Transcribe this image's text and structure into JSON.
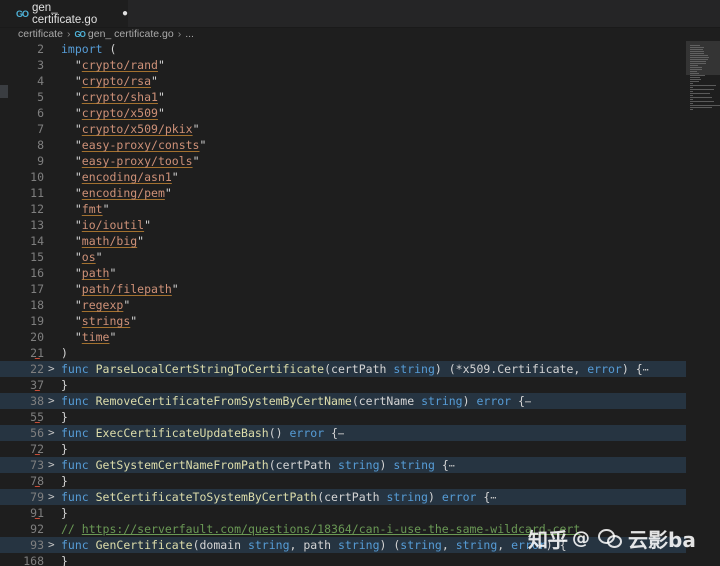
{
  "tab": {
    "filename": "gen_ certificate.go",
    "icon": "go-file-icon",
    "modified_indicator": "●"
  },
  "breadcrumb": {
    "folder": "certificate",
    "file": "gen_ certificate.go",
    "more": "..."
  },
  "lines": [
    {
      "n": "2",
      "fold": "",
      "parts": [
        [
          "kw",
          "import"
        ],
        [
          "p",
          " ("
        ]
      ]
    },
    {
      "n": "3",
      "fold": "",
      "parts": [
        [
          "p",
          "  \""
        ],
        [
          "str",
          "crypto/rand"
        ],
        [
          "p",
          "\""
        ]
      ]
    },
    {
      "n": "4",
      "fold": "",
      "parts": [
        [
          "p",
          "  \""
        ],
        [
          "str",
          "crypto/rsa"
        ],
        [
          "p",
          "\""
        ]
      ]
    },
    {
      "n": "5",
      "fold": "",
      "parts": [
        [
          "p",
          "  \""
        ],
        [
          "str",
          "crypto/sha1"
        ],
        [
          "p",
          "\""
        ]
      ]
    },
    {
      "n": "6",
      "fold": "",
      "parts": [
        [
          "p",
          "  \""
        ],
        [
          "str",
          "crypto/x509"
        ],
        [
          "p",
          "\""
        ]
      ]
    },
    {
      "n": "7",
      "fold": "",
      "parts": [
        [
          "p",
          "  \""
        ],
        [
          "str",
          "crypto/x509/pkix"
        ],
        [
          "p",
          "\""
        ]
      ]
    },
    {
      "n": "8",
      "fold": "",
      "parts": [
        [
          "p",
          "  \""
        ],
        [
          "str",
          "easy-proxy/consts"
        ],
        [
          "p",
          "\""
        ]
      ]
    },
    {
      "n": "9",
      "fold": "",
      "parts": [
        [
          "p",
          "  \""
        ],
        [
          "str",
          "easy-proxy/tools"
        ],
        [
          "p",
          "\""
        ]
      ]
    },
    {
      "n": "10",
      "fold": "",
      "parts": [
        [
          "p",
          "  \""
        ],
        [
          "str",
          "encoding/asn1"
        ],
        [
          "p",
          "\""
        ]
      ]
    },
    {
      "n": "11",
      "fold": "",
      "parts": [
        [
          "p",
          "  \""
        ],
        [
          "str",
          "encoding/pem"
        ],
        [
          "p",
          "\""
        ]
      ]
    },
    {
      "n": "12",
      "fold": "",
      "parts": [
        [
          "p",
          "  \""
        ],
        [
          "str",
          "fmt"
        ],
        [
          "p",
          "\""
        ]
      ]
    },
    {
      "n": "13",
      "fold": "",
      "parts": [
        [
          "p",
          "  \""
        ],
        [
          "str",
          "io/ioutil"
        ],
        [
          "p",
          "\""
        ]
      ]
    },
    {
      "n": "14",
      "fold": "",
      "parts": [
        [
          "p",
          "  \""
        ],
        [
          "str",
          "math/big"
        ],
        [
          "p",
          "\""
        ]
      ]
    },
    {
      "n": "15",
      "fold": "",
      "parts": [
        [
          "p",
          "  \""
        ],
        [
          "str",
          "os"
        ],
        [
          "p",
          "\""
        ]
      ]
    },
    {
      "n": "16",
      "fold": "",
      "parts": [
        [
          "p",
          "  \""
        ],
        [
          "str",
          "path"
        ],
        [
          "p",
          "\""
        ]
      ]
    },
    {
      "n": "17",
      "fold": "",
      "parts": [
        [
          "p",
          "  \""
        ],
        [
          "str",
          "path/filepath"
        ],
        [
          "p",
          "\""
        ]
      ]
    },
    {
      "n": "18",
      "fold": "",
      "parts": [
        [
          "p",
          "  \""
        ],
        [
          "str",
          "regexp"
        ],
        [
          "p",
          "\""
        ]
      ]
    },
    {
      "n": "19",
      "fold": "",
      "parts": [
        [
          "p",
          "  \""
        ],
        [
          "str",
          "strings"
        ],
        [
          "p",
          "\""
        ]
      ]
    },
    {
      "n": "20",
      "fold": "",
      "parts": [
        [
          "p",
          "  \""
        ],
        [
          "str",
          "time"
        ],
        [
          "p",
          "\""
        ]
      ]
    },
    {
      "n": "21",
      "fold": "",
      "parts": [
        [
          "p",
          ")"
        ]
      ]
    },
    {
      "n": "22",
      "fold": ">",
      "hl": true,
      "parts": [
        [
          "kw",
          "func "
        ],
        [
          "fn",
          "ParseLocalCertStringToCertificate"
        ],
        [
          "p",
          "(certPath "
        ],
        [
          "ty",
          "string"
        ],
        [
          "p",
          ") (*x509.Certificate, "
        ],
        [
          "ty",
          "error"
        ],
        [
          "p",
          ") {"
        ],
        [
          "ell",
          "⋯"
        ]
      ]
    },
    {
      "n": "37",
      "fold": "",
      "parts": [
        [
          "p",
          "}"
        ]
      ]
    },
    {
      "n": "38",
      "fold": ">",
      "hl": true,
      "parts": [
        [
          "kw",
          "func "
        ],
        [
          "fn",
          "RemoveCertificateFromSystemByCertName"
        ],
        [
          "p",
          "(certName "
        ],
        [
          "ty",
          "string"
        ],
        [
          "p",
          ") "
        ],
        [
          "ty",
          "error"
        ],
        [
          "p",
          " {"
        ],
        [
          "ell",
          "⋯"
        ]
      ]
    },
    {
      "n": "55",
      "fold": "",
      "parts": [
        [
          "p",
          "}"
        ]
      ]
    },
    {
      "n": "56",
      "fold": ">",
      "hl": true,
      "parts": [
        [
          "kw",
          "func "
        ],
        [
          "fn",
          "ExecCertificateUpdateBash"
        ],
        [
          "p",
          "() "
        ],
        [
          "ty",
          "error"
        ],
        [
          "p",
          " {"
        ],
        [
          "ell",
          "⋯"
        ]
      ]
    },
    {
      "n": "72",
      "fold": "",
      "parts": [
        [
          "p",
          "}"
        ]
      ]
    },
    {
      "n": "73",
      "fold": ">",
      "hl": true,
      "parts": [
        [
          "kw",
          "func "
        ],
        [
          "fn",
          "GetSystemCertNameFromPath"
        ],
        [
          "p",
          "(certPath "
        ],
        [
          "ty",
          "string"
        ],
        [
          "p",
          ") "
        ],
        [
          "ty",
          "string"
        ],
        [
          "p",
          " {"
        ],
        [
          "ell",
          "⋯"
        ]
      ]
    },
    {
      "n": "78",
      "fold": "",
      "parts": [
        [
          "p",
          "}"
        ]
      ]
    },
    {
      "n": "79",
      "fold": ">",
      "hl": true,
      "parts": [
        [
          "kw",
          "func "
        ],
        [
          "fn",
          "SetCertificateToSystemByCertPath"
        ],
        [
          "p",
          "(certPath "
        ],
        [
          "ty",
          "string"
        ],
        [
          "p",
          ") "
        ],
        [
          "ty",
          "error"
        ],
        [
          "p",
          " {"
        ],
        [
          "ell",
          "⋯"
        ]
      ]
    },
    {
      "n": "91",
      "fold": "",
      "parts": [
        [
          "p",
          "}"
        ]
      ]
    },
    {
      "n": "92",
      "fold": "",
      "parts": [
        [
          "cm",
          "// "
        ],
        [
          "cml",
          "https://serverfault.com/questions/18364/can-i-use-the-same-wildcard-cert"
        ]
      ]
    },
    {
      "n": "93",
      "fold": ">",
      "hl": true,
      "parts": [
        [
          "kw",
          "func "
        ],
        [
          "fn",
          "GenCertificate"
        ],
        [
          "p",
          "(domain "
        ],
        [
          "ty",
          "string"
        ],
        [
          "p",
          ", path "
        ],
        [
          "ty",
          "string"
        ],
        [
          "p",
          ") ("
        ],
        [
          "ty",
          "string"
        ],
        [
          "p",
          ", "
        ],
        [
          "ty",
          "string"
        ],
        [
          "p",
          ", "
        ],
        [
          "ty",
          "error"
        ],
        [
          "p",
          ") {"
        ]
      ]
    },
    {
      "n": "168",
      "fold": "",
      "parts": [
        [
          "p",
          "}"
        ]
      ]
    }
  ],
  "red_marks_after": [
    "21",
    "37",
    "55",
    "72",
    "78",
    "91"
  ],
  "watermark": {
    "site": "知乎",
    "separator": "@",
    "author": "云影ba"
  },
  "colors": {
    "keyword": "#569cd6",
    "function": "#dcdcaa",
    "string": "#ce9178",
    "comment": "#6a9955",
    "highlight": "#263441"
  }
}
